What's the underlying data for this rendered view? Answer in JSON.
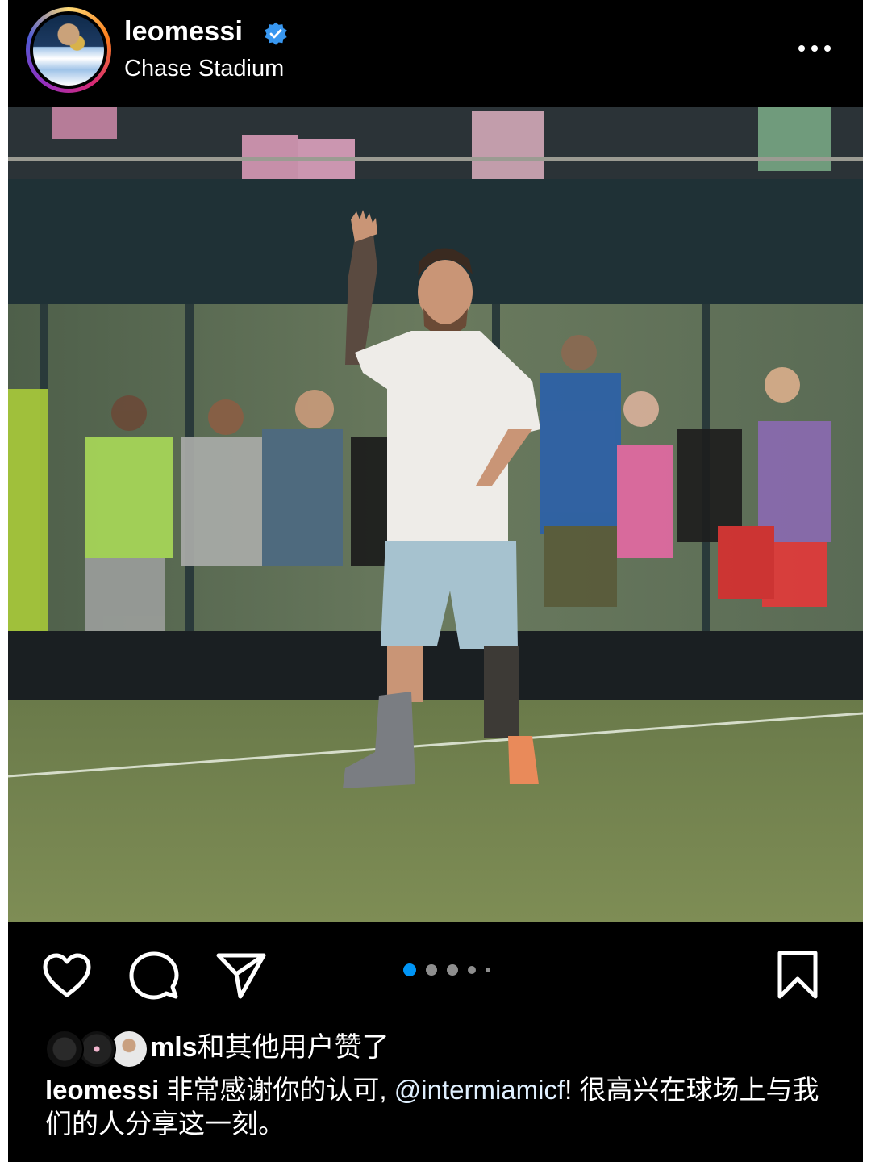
{
  "header": {
    "username": "leomessi",
    "location": "Chase Stadium",
    "verified_icon": "verified-badge-icon",
    "more_icon": "more-options-icon"
  },
  "post": {
    "carousel": {
      "total": 5,
      "active_index": 0
    }
  },
  "actions": {
    "like_icon": "heart-icon",
    "comment_icon": "comment-icon",
    "share_icon": "send-icon",
    "save_icon": "bookmark-icon"
  },
  "likes": {
    "user": "mls",
    "suffix": "和其他用户赞了"
  },
  "caption": {
    "user": "leomessi",
    "text_before": "非常感谢你的认可, ",
    "mention": "@intermiamicf",
    "text_after": "! 很高兴在球场上与我们的人分享这一刻。"
  },
  "colors": {
    "background": "#000000",
    "text": "#ffffff",
    "verified": "#3897f0",
    "active_dot": "#0095f6",
    "inactive_dot": "#8e8e8e"
  }
}
